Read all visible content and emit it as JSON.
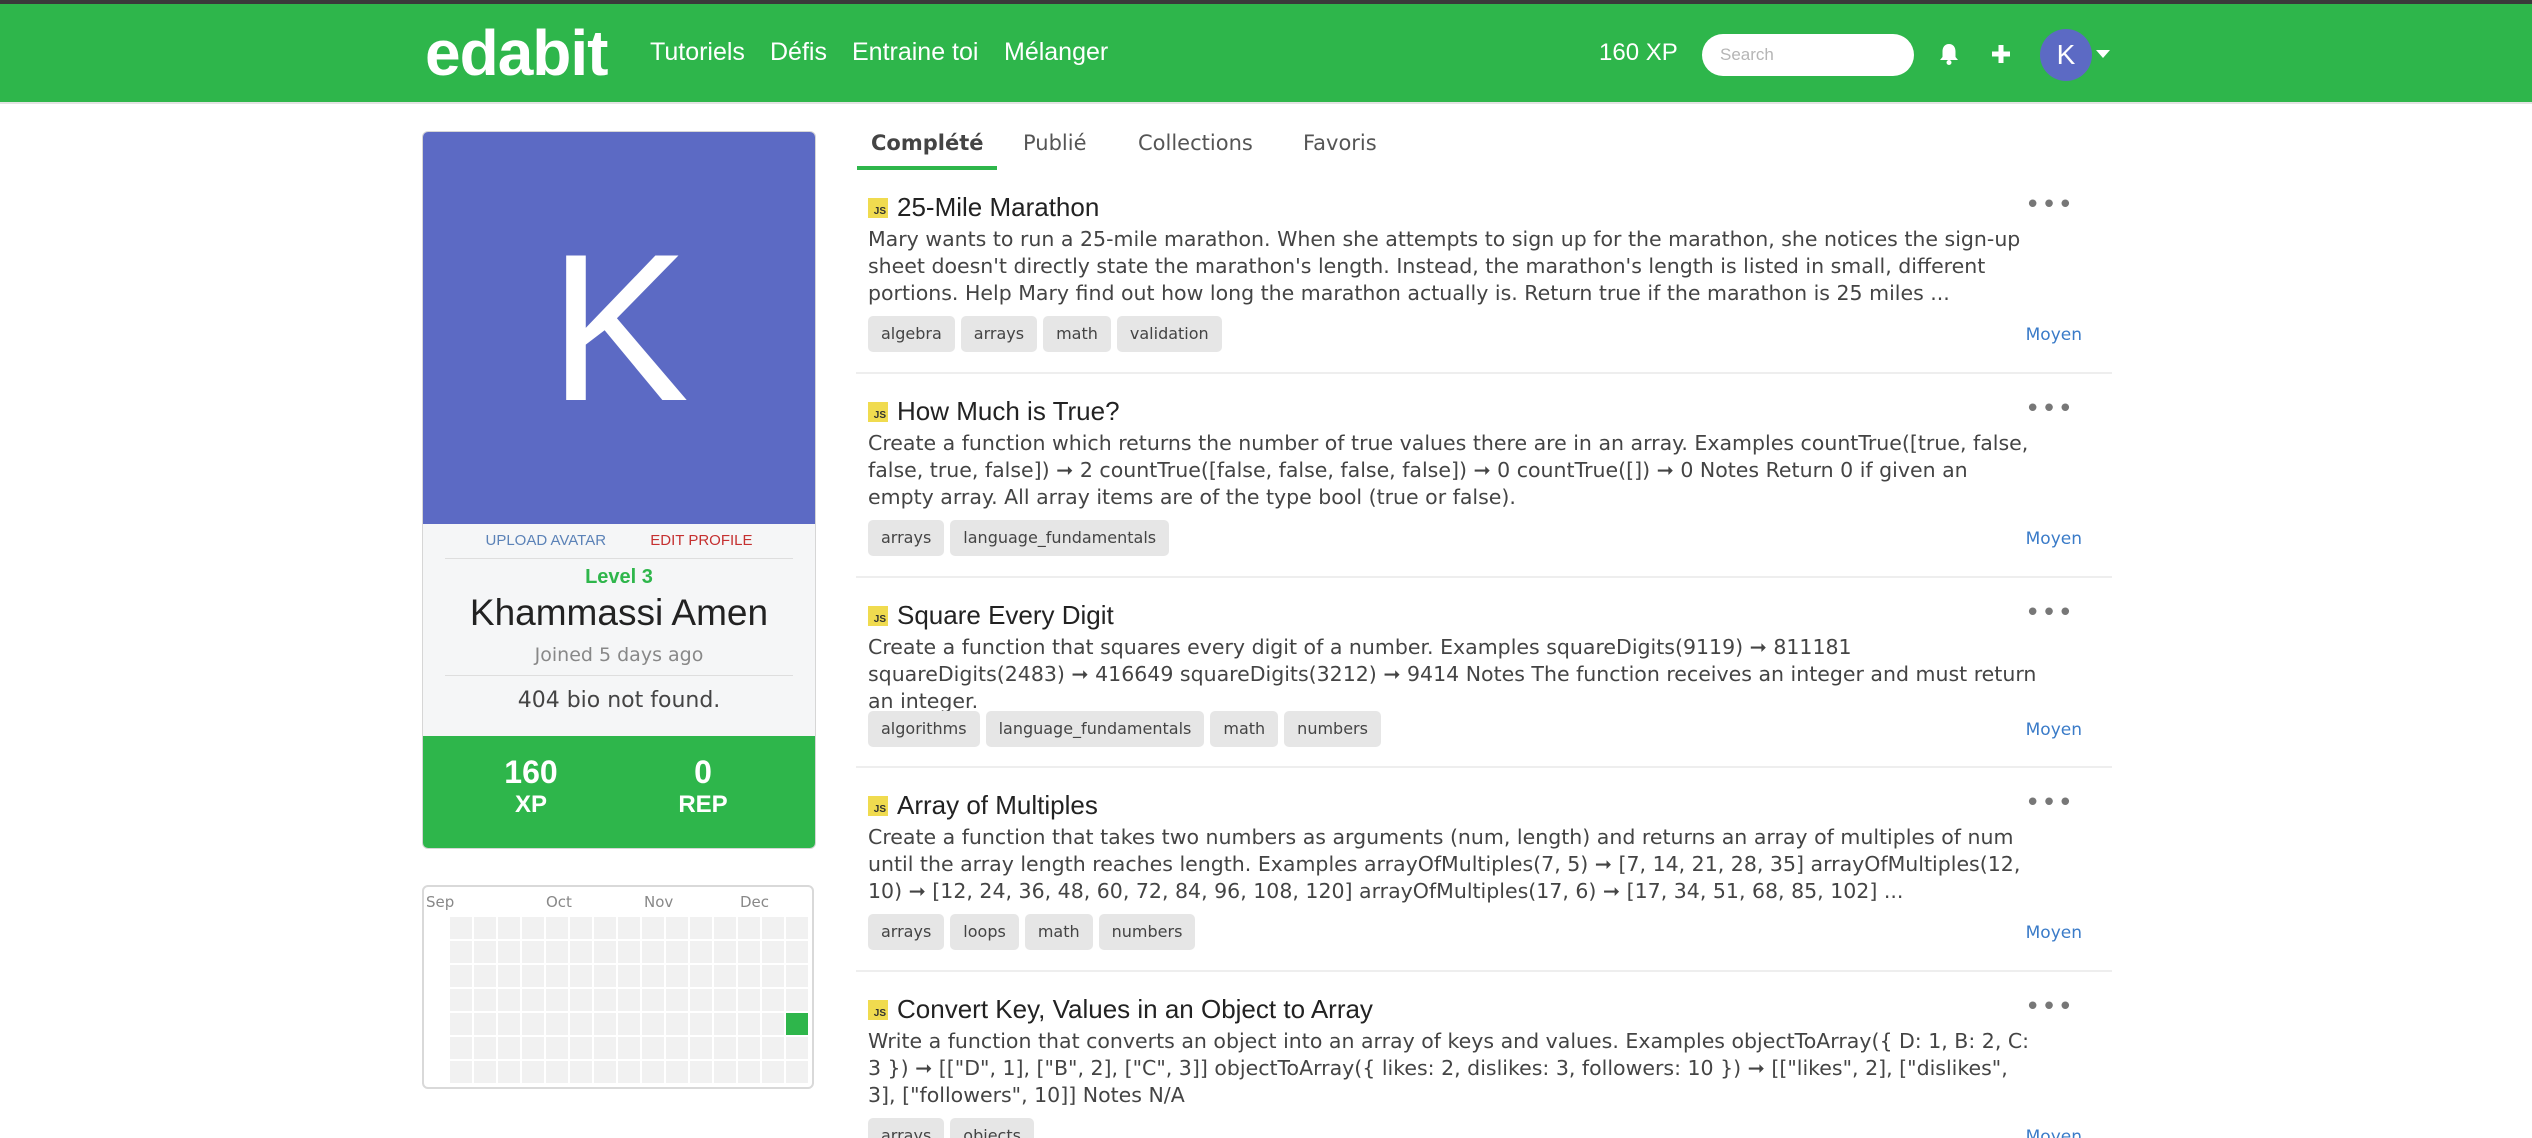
{
  "navbar": {
    "logo": "edabit",
    "links": [
      "Tutoriels",
      "Défis",
      "Entraine toi",
      "Mélanger"
    ],
    "xp": "160 XP",
    "search_placeholder": "Search",
    "avatar_letter": "K",
    "icons": [
      "bell-icon",
      "plus-icon",
      "caret-down-icon"
    ],
    "colors": {
      "brand": "#2eb64b",
      "avatar": "#5c6ac4"
    }
  },
  "profile": {
    "avatar_letter": "K",
    "upload_avatar": "UPLOAD AVATAR",
    "edit_profile": "EDIT PROFILE",
    "level": "Level 3",
    "name": "Khammassi Amen",
    "joined": "Joined 5 days ago",
    "bio": "404 bio not found.",
    "stats": [
      {
        "value": "160",
        "label": "XP"
      },
      {
        "value": "0",
        "label": "REP"
      }
    ]
  },
  "activity": {
    "months": [
      "Sep",
      "Oct",
      "Nov",
      "Dec"
    ]
  },
  "tabs": [
    "Complété",
    "Publié",
    "Collections",
    "Favoris"
  ],
  "challenges": [
    {
      "lang": "JS",
      "title": "25-Mile Marathon",
      "description": "Mary wants to run a 25-mile marathon. When she attempts to sign up for the marathon, she notices the sign-up sheet doesn't directly state the marathon's length. Instead, the marathon's length is listed in small, different portions. Help Mary find out how long the marathon actually is. Return true if the marathon is 25 miles ...",
      "tags": [
        "algebra",
        "arrays",
        "math",
        "validation"
      ],
      "difficulty": "Moyen",
      "menu": "•••"
    },
    {
      "lang": "JS",
      "title": "How Much is True?",
      "description": "Create a function which returns the number of true values there are in an array. Examples countTrue([true, false, false, true, false]) ➞ 2 countTrue([false, false, false, false]) ➞ 0 countTrue([]) ➞ 0 Notes Return 0 if given an empty array. All array items are of the type bool (true or false).",
      "tags": [
        "arrays",
        "language_fundamentals"
      ],
      "difficulty": "Moyen",
      "menu": "•••"
    },
    {
      "lang": "JS",
      "title": "Square Every Digit",
      "description": "Create a function that squares every digit of a number. Examples squareDigits(9119) ➞ 811181 squareDigits(2483) ➞ 416649 squareDigits(3212) ➞ 9414 Notes The function receives an integer and must return an integer.",
      "tags": [
        "algorithms",
        "language_fundamentals",
        "math",
        "numbers"
      ],
      "difficulty": "Moyen",
      "menu": "•••"
    },
    {
      "lang": "JS",
      "title": "Array of Multiples",
      "description": "Create a function that takes two numbers as arguments (num, length) and returns an array of multiples of num until the array length reaches length. Examples arrayOfMultiples(7, 5) ➞ [7, 14, 21, 28, 35] arrayOfMultiples(12, 10) ➞ [12, 24, 36, 48, 60, 72, 84, 96, 108, 120] arrayOfMultiples(17, 6) ➞ [17, 34, 51, 68, 85, 102] ...",
      "tags": [
        "arrays",
        "loops",
        "math",
        "numbers"
      ],
      "difficulty": "Moyen",
      "menu": "•••"
    },
    {
      "lang": "JS",
      "title": "Convert Key, Values in an Object to Array",
      "description": "Write a function that converts an object into an array of keys and values. Examples objectToArray({ D: 1, B: 2, C: 3 }) ➞ [[\"D\", 1], [\"B\", 2], [\"C\", 3]] objectToArray({ likes: 2, dislikes: 3, followers: 10 }) ➞ [[\"likes\", 2], [\"dislikes\", 3], [\"followers\", 10]] Notes N/A",
      "tags": [
        "arrays",
        "objects"
      ],
      "difficulty": "Moyen",
      "menu": "•••"
    }
  ]
}
